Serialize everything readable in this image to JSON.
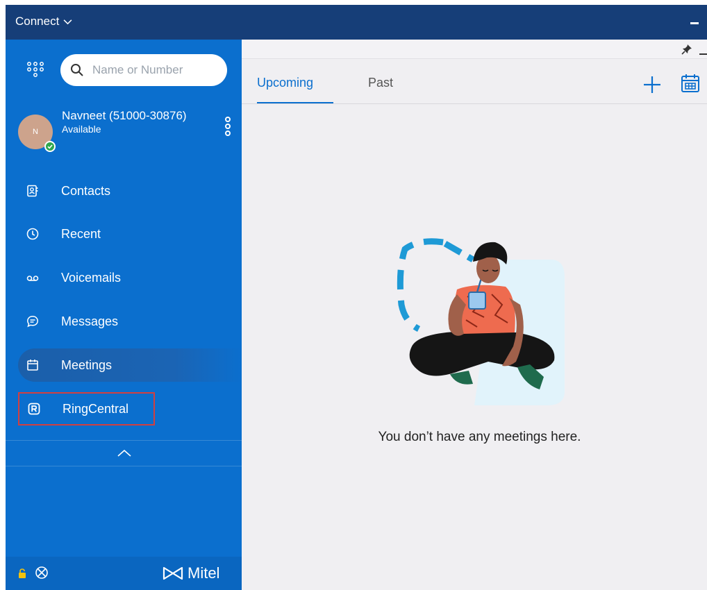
{
  "titlebar": {
    "app_menu_label": "Connect"
  },
  "sidebar": {
    "search": {
      "placeholder": "Name or Number"
    },
    "profile": {
      "initial": "N",
      "name": "Navneet (51000-30876)",
      "status": "Available"
    },
    "nav": [
      {
        "label": "Contacts",
        "icon": "contacts-icon"
      },
      {
        "label": "Recent",
        "icon": "recent-icon"
      },
      {
        "label": "Voicemails",
        "icon": "voicemail-icon"
      },
      {
        "label": "Messages",
        "icon": "messages-icon"
      },
      {
        "label": "Meetings",
        "icon": "meetings-icon",
        "active": true
      },
      {
        "label": "RingCentral",
        "icon": "ringcentral-icon",
        "highlighted": true
      }
    ],
    "footer": {
      "brand": "Mitel"
    }
  },
  "main": {
    "tabs": [
      {
        "label": "Upcoming",
        "selected": true
      },
      {
        "label": "Past",
        "selected": false
      }
    ],
    "empty_message": "You don’t have any meetings here."
  },
  "colors": {
    "titlebar": "#163e78",
    "sidebar": "#0b6fce",
    "accent": "#0b6fce",
    "highlight_border": "#d33f3f",
    "presence_available": "#2fa84f"
  }
}
